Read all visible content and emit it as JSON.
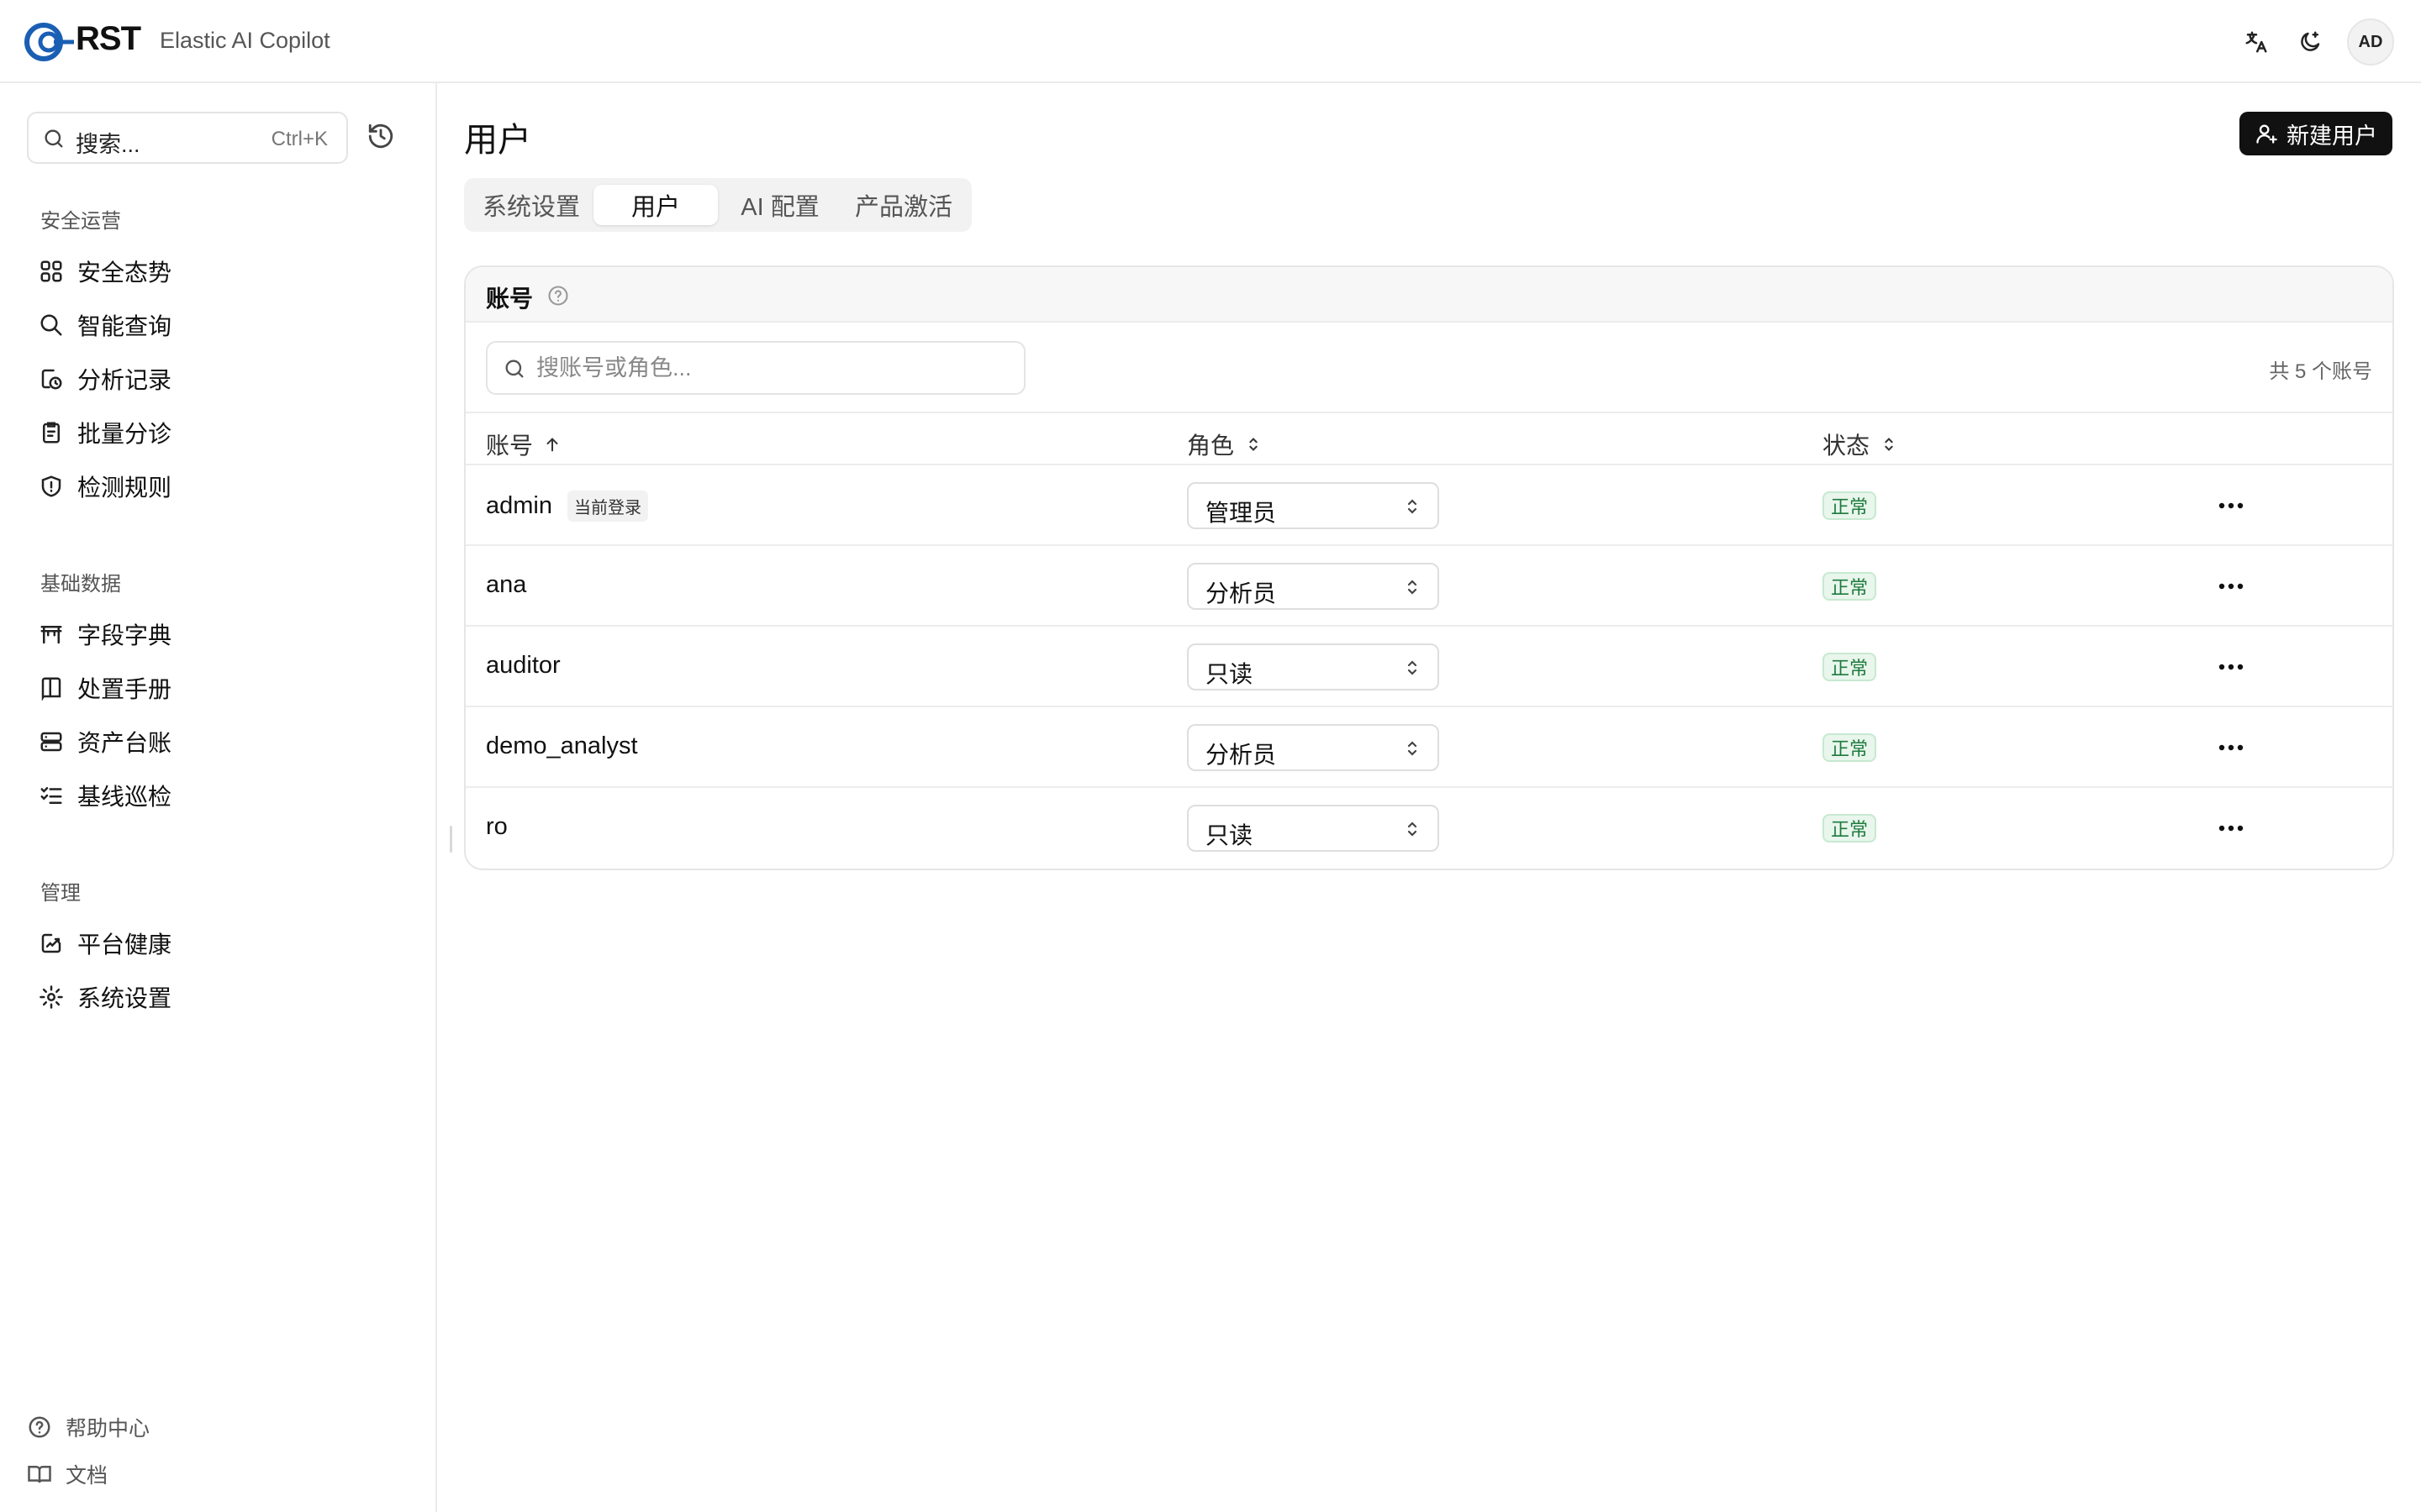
{
  "header": {
    "brand": "RST",
    "product": "Elastic AI Copilot",
    "avatar": "AD",
    "icons": [
      "translate-icon",
      "theme-moon-icon"
    ]
  },
  "sidebar": {
    "search": {
      "placeholder": "搜索...",
      "shortcut": "Ctrl+K"
    },
    "groups": [
      {
        "title": "安全运营",
        "items": [
          {
            "label": "安全态势",
            "icon": "grid-icon"
          },
          {
            "label": "智能查询",
            "icon": "search-icon"
          },
          {
            "label": "分析记录",
            "icon": "history-icon"
          },
          {
            "label": "批量分诊",
            "icon": "clipboard-icon"
          },
          {
            "label": "检测规则",
            "icon": "shield-icon"
          }
        ]
      },
      {
        "title": "基础数据",
        "items": [
          {
            "label": "字段字典",
            "icon": "table-icon"
          },
          {
            "label": "处置手册",
            "icon": "book-icon"
          },
          {
            "label": "资产台账",
            "icon": "server-icon"
          },
          {
            "label": "基线巡检",
            "icon": "checklist-icon"
          }
        ]
      },
      {
        "title": "管理",
        "items": [
          {
            "label": "平台健康",
            "icon": "chart-icon"
          },
          {
            "label": "系统设置",
            "icon": "gear-icon"
          }
        ]
      }
    ],
    "footer": [
      {
        "label": "帮助中心",
        "icon": "help-icon"
      },
      {
        "label": "文档",
        "icon": "book-open-icon"
      }
    ]
  },
  "main": {
    "title": "用户",
    "new_button": "新建用户",
    "tabs": [
      {
        "label": "系统设置",
        "active": false
      },
      {
        "label": "用户",
        "active": true
      },
      {
        "label": "AI 配置",
        "active": false
      },
      {
        "label": "产品激活",
        "active": false
      }
    ],
    "card": {
      "title": "账号",
      "search_placeholder": "搜账号或角色...",
      "count": "共 5 个账号",
      "columns": [
        "账号",
        "角色",
        "状态"
      ],
      "rows": [
        {
          "account": "admin",
          "current": "当前登录",
          "role": "管理员",
          "status": "正常"
        },
        {
          "account": "ana",
          "current": "",
          "role": "分析员",
          "status": "正常"
        },
        {
          "account": "auditor",
          "current": "",
          "role": "只读",
          "status": "正常"
        },
        {
          "account": "demo_analyst",
          "current": "",
          "role": "分析员",
          "status": "正常"
        },
        {
          "account": "ro",
          "current": "",
          "role": "只读",
          "status": "正常"
        }
      ]
    }
  },
  "colors": {
    "accent": "#1a5fb4",
    "button_bg": "#111111",
    "status_green": "#1f7a3e"
  }
}
